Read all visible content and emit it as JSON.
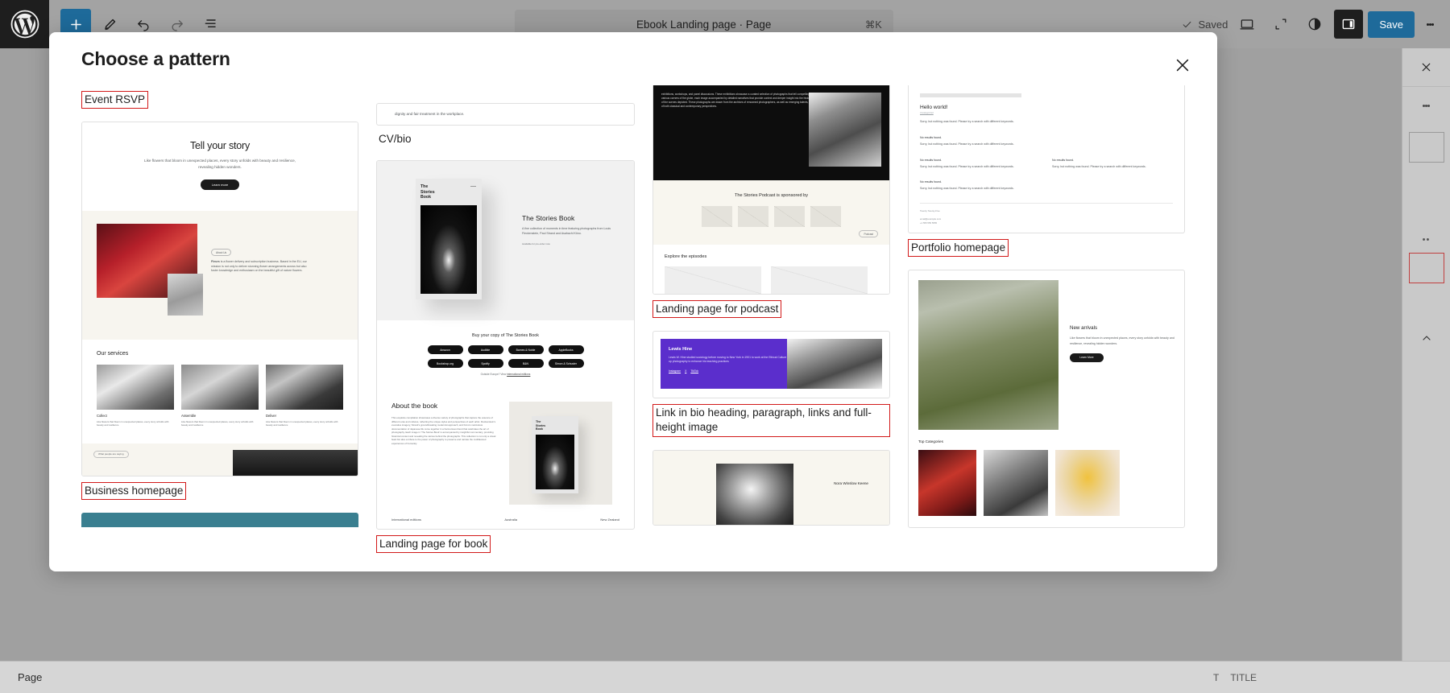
{
  "topbar": {
    "logo_icon": "wordpress-logo-icon",
    "add_block_icon": "plus-icon",
    "edit_icon": "pencil-icon",
    "undo_icon": "undo-icon",
    "redo_icon": "redo-icon",
    "list_view_icon": "list-view-icon",
    "command_title": "Ebook Landing page · Page",
    "command_shortcut": "⌘K",
    "saved_label": "Saved",
    "saved_check_icon": "check-icon",
    "view_icon": "desktop-icon",
    "zoom_out_icon": "zoom-out-icon",
    "styles_icon": "contrast-half-circle-icon",
    "settings_icon": "settings-sidebar-icon",
    "save_label": "Save",
    "more_icon": "kebab-menu-icon"
  },
  "modal": {
    "title": "Choose a pattern",
    "close_icon": "close-icon"
  },
  "bottom_bar": {
    "label": "Page"
  },
  "patterns": {
    "event_rsvp": {
      "label": "Event RSVP"
    },
    "business_homepage": {
      "label": "Business homepage",
      "hero_title": "Tell your story",
      "hero_paragraph": "Like flowers that bloom in unexpected places, every story unfolds with beauty and resilience, revealing hidden wonders.",
      "hero_button": "Learn more",
      "about_pill": "About Us",
      "about_text_lead": "Fleurs",
      "about_text": " is a flower delivery and subscription business. Based in the EU, our mission is not only to deliver stunning flower arrangements across but also foster knowledge and enthusiasm on the beautiful gift of nature flowers.",
      "services_heading": "Our services",
      "services": [
        {
          "title": "Collect",
          "text": "Like flowers that bloom in unexpected places, every story unfolds with beauty and resilience"
        },
        {
          "title": "Assemble",
          "text": "Like flowers that bloom in unexpected places, every story unfolds with beauty and resilience"
        },
        {
          "title": "Deliver",
          "text": "Like flowers that bloom in unexpected places, every story unfolds with beauty and resilience"
        }
      ],
      "footer_pill": "What people are saying"
    },
    "cv_bio": {
      "label": "CV/bio",
      "cutoff_text": "dignity and fair treatment in the workplace."
    },
    "landing_page_book": {
      "label": "Landing page for book",
      "book_cover_title": "The\nStories\nBook",
      "title": "The Stories Book",
      "description": "A fine collection of moments in time featuring photographs from Louis Fleckenstein, Paul Strand and Asahachi Kōno.",
      "availability": "Available for pre-order now",
      "buy_heading": "Buy your copy of The Stories Book",
      "retailers_row1": [
        "Amazon",
        "Audible",
        "Barnes & Noble",
        "AppleBooks"
      ],
      "retailers_row2": [
        "Bookshop.org",
        "Spotify",
        "B&N",
        "Simon & Schuster"
      ],
      "outside_note_prefix": "Outside Europe? View ",
      "outside_note_link": "international editions",
      "about_heading": "About the book",
      "about_text": "This exquisite compilation showcases a diverse variety of photographs that capture the essence of different eras and cultures, reflecting the unique styles and perspectives of each artist. Fleckenstein's evocative imagery, Strand's groundbreaking modernist approach, and Kōno's meticulous documentation of Japanese life come together in a harmonious blend that celebrates the art of photography. Each image in 'The Stories Book' is accompanied by insightful commentary, providing historical context and revealing the stories behind the photographs. This collection is not only a visual feast but also a tribute to the power of photography to preserve and narrate the multifaceted experiences of humanity.",
      "footer_left": "International editions",
      "footer_mid": "Australia",
      "footer_right": "New Zealand"
    },
    "landing_page_podcast": {
      "label": "Landing page for podcast",
      "dark_paragraph": "exhibitions, workshops, and panel discussions. These exhibitions showcase a curated selection of photographs that tell compelling stories from various corners of the globe, each image accompanied by detailed narratives that provide context and deeper insight into the historical significance of the scenes depicted. These photographs are drawn from the archives of renowned photographers, as well as emerging talents, ensuring a blend of both classical and contemporary perspectives.",
      "sponsor_heading": "The Stories Podcast is sponsored by",
      "episodes_heading": "Explore the episodes",
      "podcast_pill": "Podcast"
    },
    "link_in_bio": {
      "label": "Link in bio heading, paragraph, links and full-height image",
      "name": "Lewis Hine",
      "bio": "Lewis W. Hine studied sociology before moving to New York in 1901 to work at the Ethical Culture School, where he took up photography to enhance his teaching practices",
      "links": [
        "Instagram",
        "X",
        "TikTok"
      ],
      "accent_color": "#5b2ecc"
    },
    "quote_card": {
      "name": "Nora Winslow Keene"
    },
    "portfolio_homepage": {
      "label": "Portfolio homepage",
      "hello_title": "Hello world!",
      "hello_sub": "Uncategorized",
      "hello_text": "Sorry, but nothing was found. Please try a search with different keywords.",
      "no_results_heading": "No results found.",
      "no_results_text": "Sorry, but nothing was found. Please try a search with different keywords.",
      "two_col_text": "Sorry, but nothing was found. Please try a search with different keywords.",
      "footer_credit": "Twenty Twenty-Five",
      "footer_email": "email@example.com",
      "footer_phone": "+1 555 555 5555"
    },
    "ecommerce": {
      "heading": "New arrivals",
      "text": "Like flowers that bloom in unexpected places, every story unfolds with beauty and resilience, revealing hidden wonders.",
      "button": "Learn More",
      "categories_heading": "Top Categories"
    }
  }
}
